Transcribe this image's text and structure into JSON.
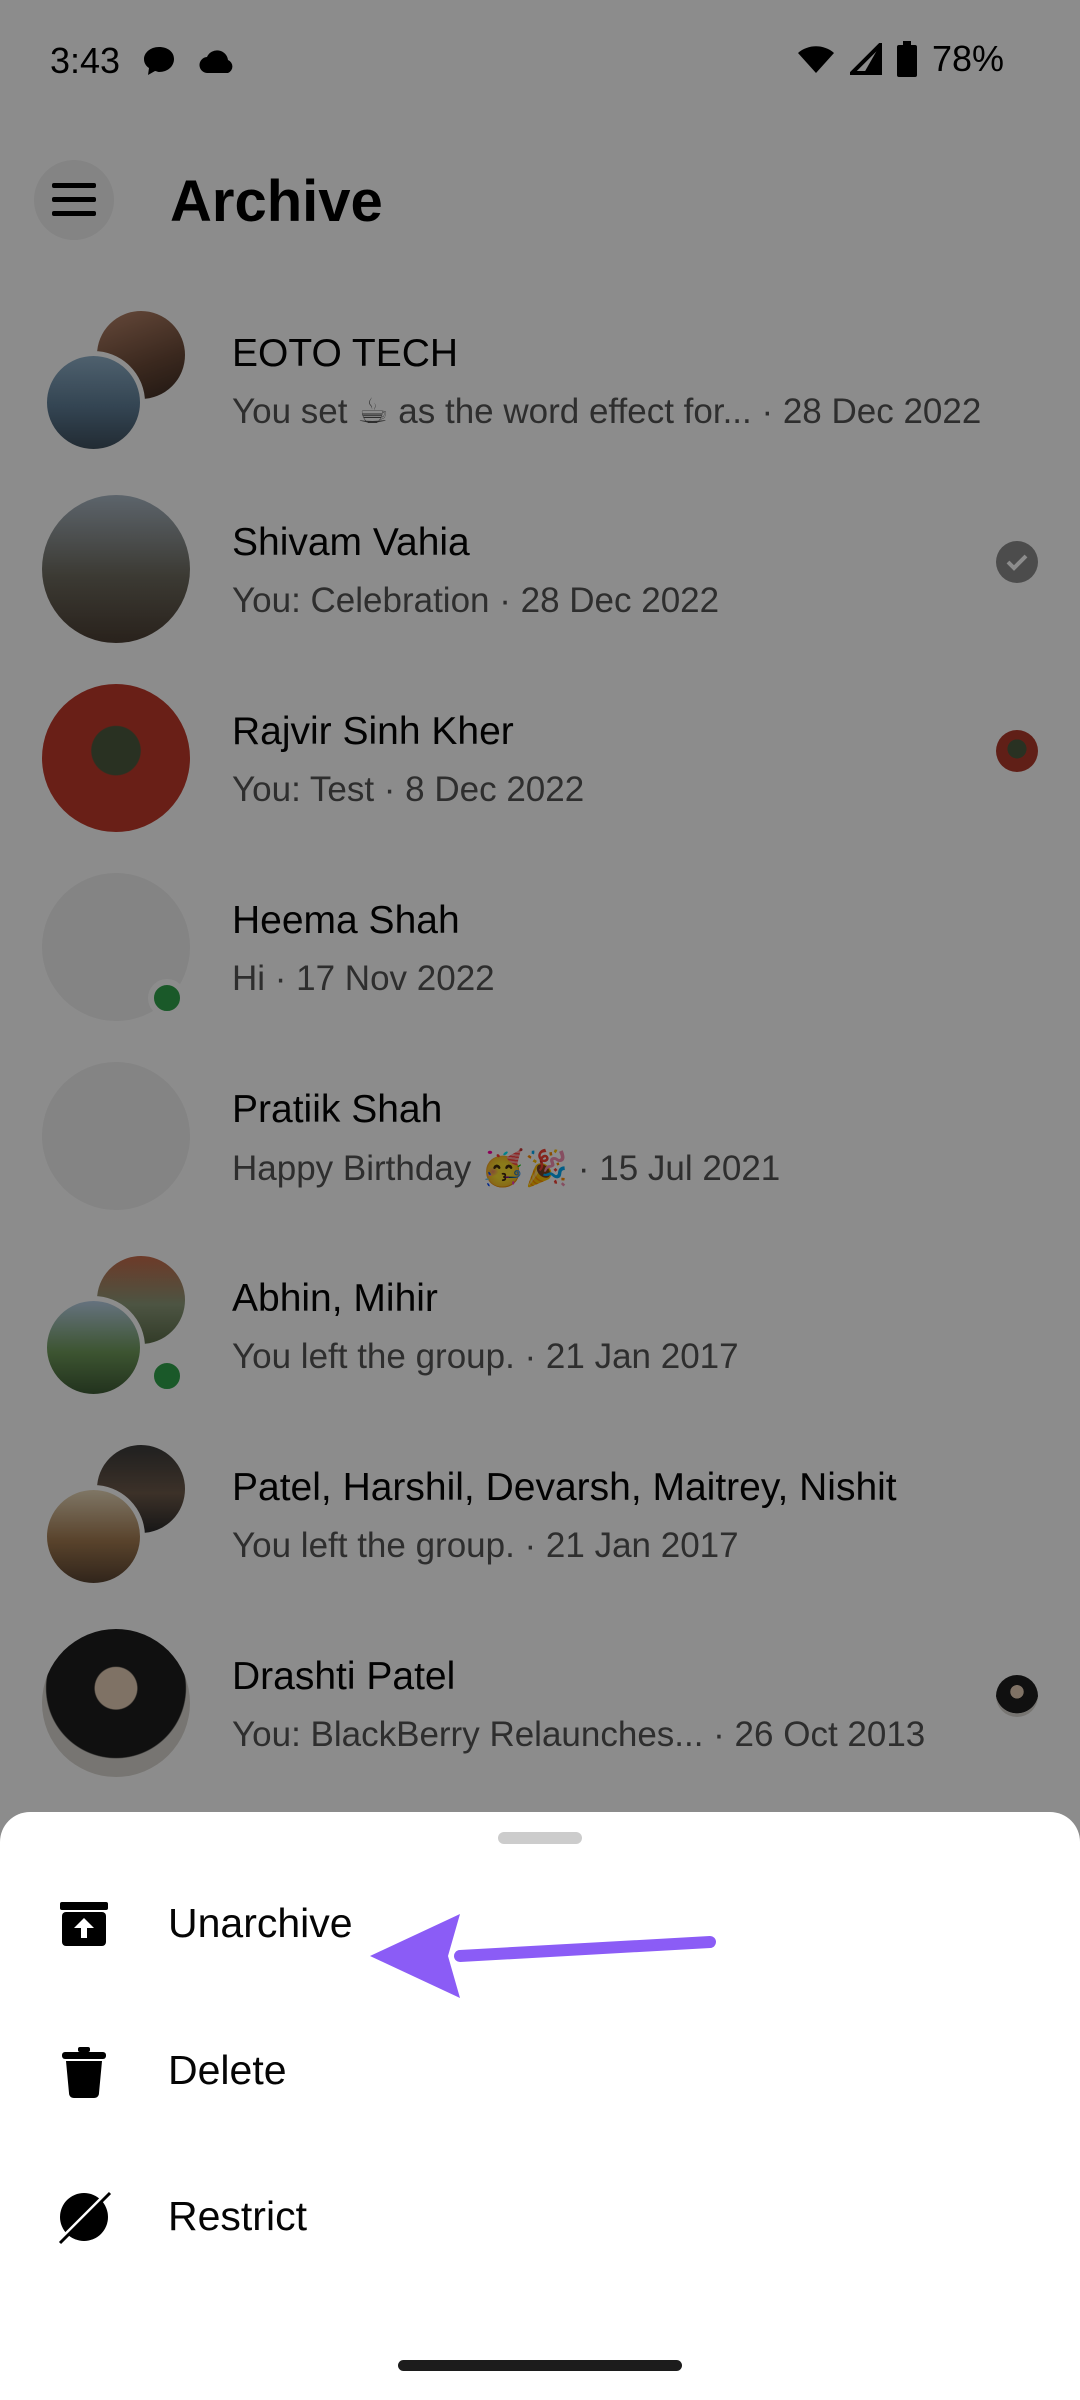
{
  "status_bar": {
    "time": "3:43",
    "battery": "78%",
    "left_icons": [
      "chat-bubble-icon",
      "cloud-icon"
    ],
    "right_icons": [
      "wifi-icon",
      "signal-icon",
      "battery-icon"
    ]
  },
  "header": {
    "title": "Archive",
    "menu_icon": "hamburger-menu-icon"
  },
  "conversations": [
    {
      "name": "EOTO TECH",
      "preview": "You set ☕ as the word effect for...  · 28 Dec 2022",
      "avatar": "group",
      "status": ""
    },
    {
      "name": "Shivam Vahia",
      "preview": "You: Celebration · 28 Dec 2022",
      "avatar": "single",
      "status": "sent-check"
    },
    {
      "name": "Rajvir Sinh Kher",
      "preview": "You: Test · 8 Dec 2022",
      "avatar": "single",
      "status": "seen-avatar"
    },
    {
      "name": "Heema Shah",
      "preview": "Hi · 17 Nov 2022",
      "avatar": "blank",
      "status": "",
      "online": true
    },
    {
      "name": "Pratiik Shah",
      "preview": "Happy Birthday 🥳🎉 · 15 Jul 2021",
      "avatar": "blank",
      "status": ""
    },
    {
      "name": "Abhin, Mihir",
      "preview": "You left the group.  · 21 Jan 2017",
      "avatar": "group",
      "status": "",
      "online": true
    },
    {
      "name": "Patel, Harshil, Devarsh, Maitrey, Nishit",
      "preview": "You left the group.  · 21 Jan 2017",
      "avatar": "group",
      "status": ""
    },
    {
      "name": "Drashti Patel",
      "preview": "You: BlackBerry Relaunches...  · 26 Oct 2013",
      "avatar": "single",
      "status": "seen-avatar"
    }
  ],
  "sheet": {
    "items": [
      {
        "label": "Unarchive",
        "icon": "unarchive-icon"
      },
      {
        "label": "Delete",
        "icon": "trash-icon"
      },
      {
        "label": "Restrict",
        "icon": "restrict-icon"
      }
    ]
  },
  "colors": {
    "online": "#31a24c",
    "annotation_arrow": "#8b5cf6",
    "overlay": "rgba(0,0,0,0.45)"
  }
}
